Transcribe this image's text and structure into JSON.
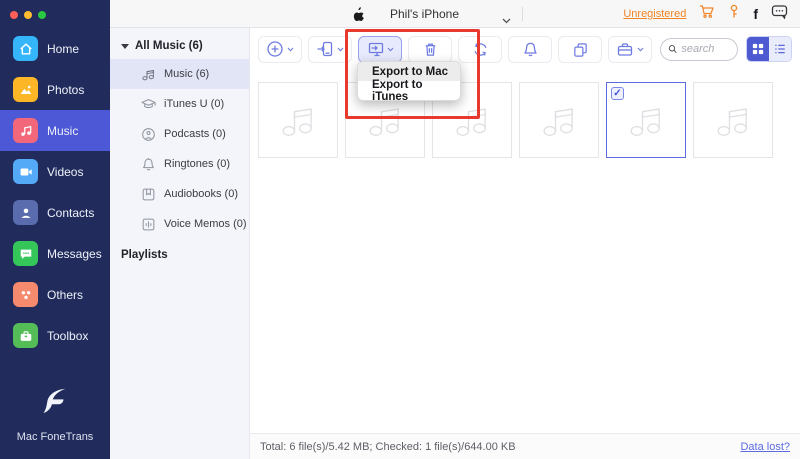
{
  "window": {
    "controls": [
      "close",
      "minimize",
      "zoom"
    ]
  },
  "sidebar": {
    "items": [
      {
        "label": "Home",
        "active": false
      },
      {
        "label": "Photos",
        "active": false
      },
      {
        "label": "Music",
        "active": true
      },
      {
        "label": "Videos",
        "active": false
      },
      {
        "label": "Contacts",
        "active": false
      },
      {
        "label": "Messages",
        "active": false
      },
      {
        "label": "Others",
        "active": false
      },
      {
        "label": "Toolbox",
        "active": false
      }
    ],
    "app_name": "Mac FoneTrans"
  },
  "devicebar": {
    "device_name": "Phil's iPhone",
    "unregistered_label": "Unregistered",
    "icons": [
      "apple-icon",
      "chevron-down-icon",
      "cart-icon",
      "key-icon",
      "facebook-icon",
      "feedback-icon"
    ]
  },
  "library": {
    "header": "All Music (6)",
    "items": [
      {
        "label": "Music (6)",
        "icon": "music-note-icon",
        "active": true
      },
      {
        "label": "iTunes U (0)",
        "icon": "graduation-cap-icon",
        "active": false
      },
      {
        "label": "Podcasts (0)",
        "icon": "podcast-icon",
        "active": false
      },
      {
        "label": "Ringtones (0)",
        "icon": "bell-icon",
        "active": false
      },
      {
        "label": "Audiobooks (0)",
        "icon": "audiobook-icon",
        "active": false
      },
      {
        "label": "Voice Memos (0)",
        "icon": "voice-memo-icon",
        "active": false
      }
    ],
    "playlists_header": "Playlists"
  },
  "toolbar": {
    "buttons": [
      "add-button",
      "export-to-device-button",
      "export-to-computer-button",
      "delete-button",
      "refresh-button",
      "ringtone-button",
      "dedupe-button",
      "toolbox-button"
    ],
    "active_button": "export-to-computer-button",
    "search_placeholder": "search",
    "view_mode": "grid",
    "export_menu": {
      "items": [
        "Export to Mac",
        "Export to iTunes"
      ],
      "hovered_index": 0
    }
  },
  "content": {
    "tiles": [
      {
        "checked": false
      },
      {
        "checked": false
      },
      {
        "checked": false
      },
      {
        "checked": false
      },
      {
        "checked": true
      },
      {
        "checked": false
      }
    ]
  },
  "statusbar": {
    "summary": "Total: 6 file(s)/5.42 MB; Checked: 1 file(s)/644.00 KB",
    "data_lost_label": "Data lost?"
  },
  "colors": {
    "accent": "#6e7be2",
    "sidebar_bg": "#212c5d",
    "sidebar_active": "#4c58d6",
    "annotation_red": "#e8392e",
    "unregistered_orange": "#ef8424",
    "link_blue": "#5b6be0"
  }
}
